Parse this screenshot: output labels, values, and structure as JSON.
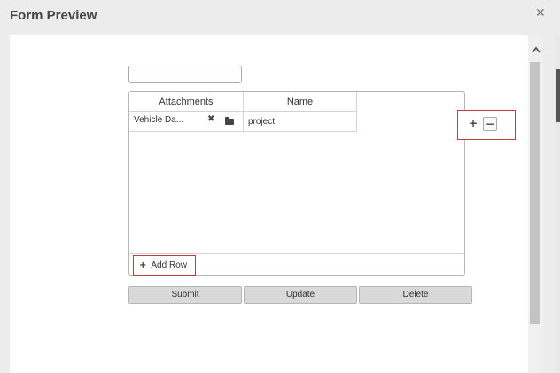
{
  "dialog": {
    "title": "Form Preview",
    "close_glyph": "✕"
  },
  "form": {
    "text_field_value": "",
    "grid": {
      "columns": [
        "Attachments",
        "Name"
      ],
      "rows": [
        {
          "attachment": "Vehicle Da...",
          "name": "project"
        }
      ],
      "add_row_label": "Add Row"
    },
    "row_controls": {
      "add_glyph": "+",
      "remove_glyph": "−"
    },
    "buttons": {
      "submit": "Submit",
      "update": "Update",
      "delete": "Delete"
    }
  },
  "icons": {
    "remove_attachment": "x-icon",
    "browse_attachment": "folder-icon",
    "add_row": "plus-icon",
    "close": "close-icon",
    "scroll_up": "chevron-up-icon"
  },
  "colors": {
    "highlight_border": "#c83a3a",
    "button_bg": "#d9d9d9",
    "dialog_bg": "#ffffff",
    "chrome_bg": "#ececec"
  }
}
